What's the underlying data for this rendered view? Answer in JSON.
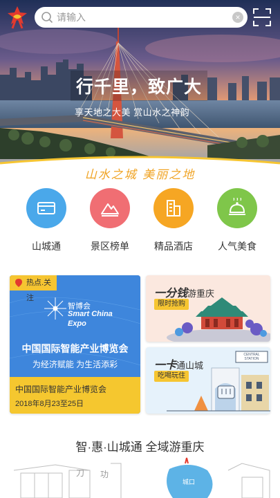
{
  "search": {
    "placeholder": "请输入",
    "clear": "×"
  },
  "hero": {
    "title": "行千里，致广大",
    "subtitle": "享天地之大美 赏山水之神韵"
  },
  "slogan": "山水之城 美丽之地",
  "nav": [
    {
      "label": "山城通",
      "icon": "card-icon",
      "color": "#4aa8ea"
    },
    {
      "label": "景区榜单",
      "icon": "mountain-icon",
      "color": "#f06e73"
    },
    {
      "label": "精品酒店",
      "icon": "hotel-icon",
      "color": "#f6a623"
    },
    {
      "label": "人气美食",
      "icon": "food-cloche-icon",
      "color": "#7fc64a"
    }
  ],
  "feature": {
    "tag": "热点.关注",
    "logo_cn": "智博会",
    "logo_en1": "Smart China",
    "logo_en2": "Expo",
    "banner_title": "中国国际智能产业博览会",
    "banner_sub": "为经济赋能 为生活添彩",
    "title": "中国国际智能产业博览会",
    "date": "2018年8月23至25日"
  },
  "promo1": {
    "big": "一分钱",
    "rest": "游重庆",
    "pill": "限时抢购"
  },
  "promo2": {
    "big": "一卡",
    "rest": "通山城",
    "pill": "吃喝玩住",
    "sign1": "CENTRAL",
    "sign2": "STATION"
  },
  "footer": {
    "title": "智·惠·山城通 全域游重庆",
    "map_label": "城口"
  },
  "colors": {
    "accent": "#f6c531",
    "slogan": "#f0a425",
    "expo_blue": "#3d7fd7"
  }
}
